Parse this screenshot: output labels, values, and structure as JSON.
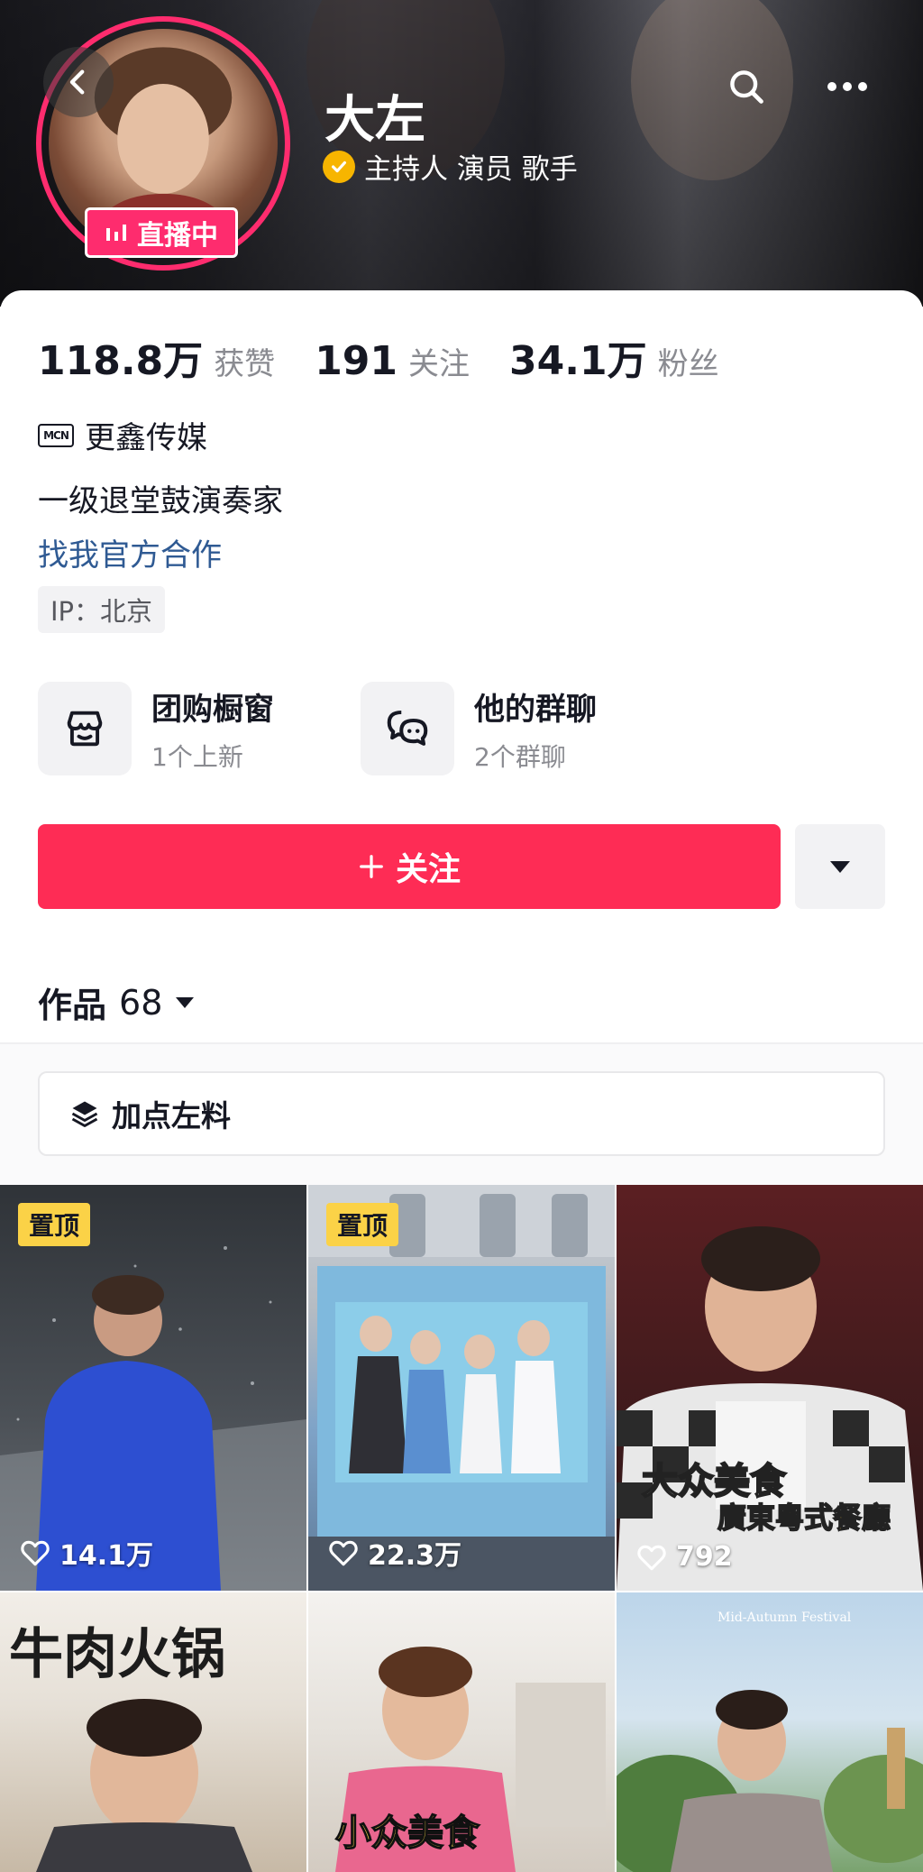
{
  "header": {
    "name": "大左",
    "roles": "主持人 演员 歌手",
    "live_badge": "直播中"
  },
  "stats": [
    {
      "value": "118.8万",
      "label": "获赞"
    },
    {
      "value": "191",
      "label": "关注"
    },
    {
      "value": "34.1万",
      "label": "粉丝"
    }
  ],
  "profile": {
    "mcn_logo": "MCN",
    "mcn_name": "更鑫传媒",
    "bio": "一级退堂鼓演奏家",
    "collab_link": "找我官方合作",
    "ip": "IP：北京"
  },
  "features": [
    {
      "title": "团购橱窗",
      "subtitle": "1个上新",
      "icon": "shop-icon"
    },
    {
      "title": "他的群聊",
      "subtitle": "2个群聊",
      "icon": "chat-icon"
    }
  ],
  "actions": {
    "follow": "关注"
  },
  "tabs": {
    "works_label": "作品",
    "works_count": "68"
  },
  "collection": {
    "label": "加点左料"
  },
  "videos": [
    {
      "pinned": "置顶",
      "likes": "14.1万"
    },
    {
      "pinned": "置顶",
      "likes": "22.3万"
    },
    {
      "pinned": "",
      "likes": "792",
      "overlay1": "大众美食",
      "overlay2": "廣東粵式餐廳"
    },
    {
      "overlay1": "牛肉火锅"
    },
    {
      "overlay1": "小众美食"
    },
    {
      "overlay1": "Mid-Autumn Festival"
    }
  ],
  "colors": {
    "accent": "#fe2c55",
    "live": "#fe2c6e",
    "link": "#2f5a93",
    "pin": "#fbd247",
    "verify": "#f7b500"
  }
}
